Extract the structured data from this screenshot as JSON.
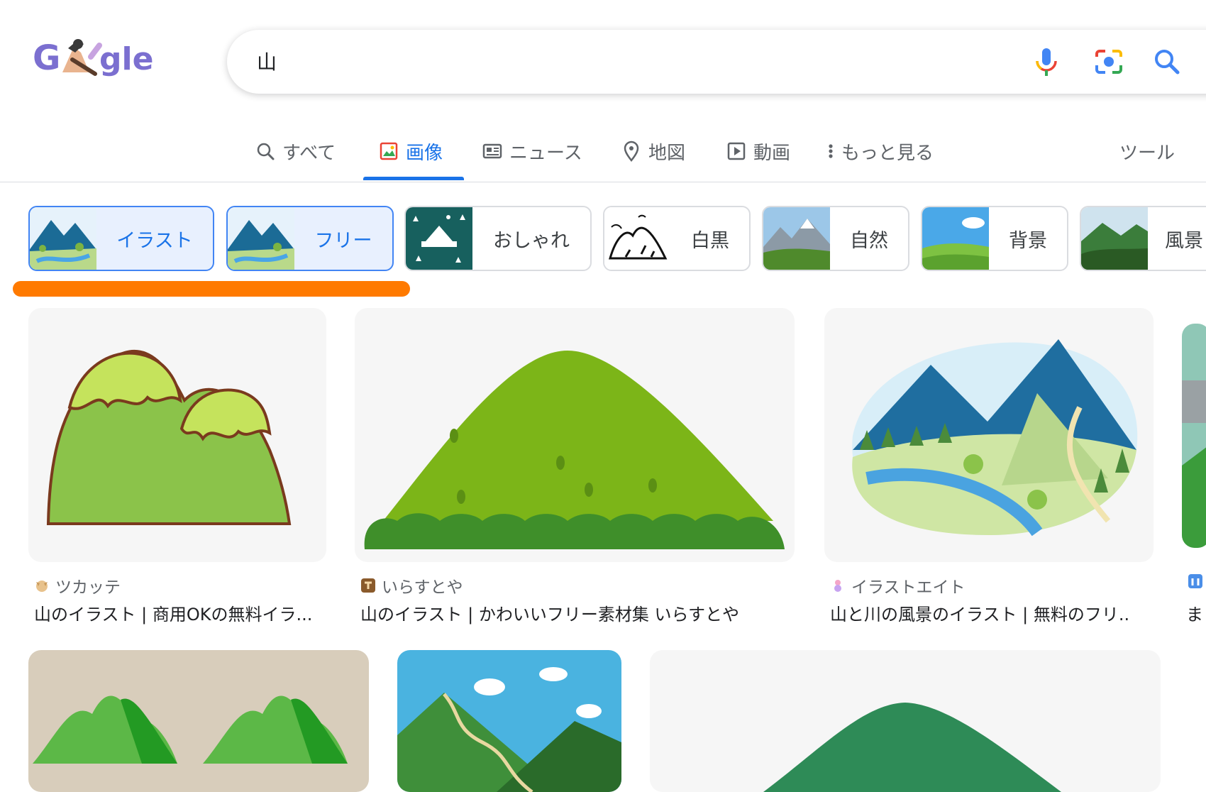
{
  "logo": {
    "alt": "Google Doodle"
  },
  "search": {
    "value": "山",
    "mic_icon": "mic-icon",
    "lens_icon": "camera-lens-icon",
    "search_icon": "search-icon"
  },
  "tabs": [
    {
      "label": "すべて",
      "icon": "search-icon"
    },
    {
      "label": "画像",
      "icon": "image-icon",
      "active": true
    },
    {
      "label": "ニュース",
      "icon": "news-icon"
    },
    {
      "label": "地図",
      "icon": "map-pin-icon"
    },
    {
      "label": "動画",
      "icon": "play-icon"
    },
    {
      "label": "もっと見る",
      "icon": "more-vert-icon"
    }
  ],
  "tools_label": "ツール",
  "chips": [
    {
      "label": "イラスト",
      "selected": true
    },
    {
      "label": "フリー",
      "selected": true
    },
    {
      "label": "おしゃれ"
    },
    {
      "label": "白黒"
    },
    {
      "label": "自然"
    },
    {
      "label": "背景"
    },
    {
      "label": "風景"
    }
  ],
  "results": [
    {
      "source": "ツカッテ",
      "title": "山のイラスト | 商用OKの無料イラ..."
    },
    {
      "source": "いらすとや",
      "title": "山のイラスト | かわいいフリー素材集 いらすとや"
    },
    {
      "source": "イラストエイト",
      "title": "山と川の風景のイラスト | 無料のフリ..."
    },
    {
      "source": "",
      "title": "ま"
    }
  ],
  "colors": {
    "accent": "#1a73e8",
    "highlight": "#ff7a00"
  }
}
